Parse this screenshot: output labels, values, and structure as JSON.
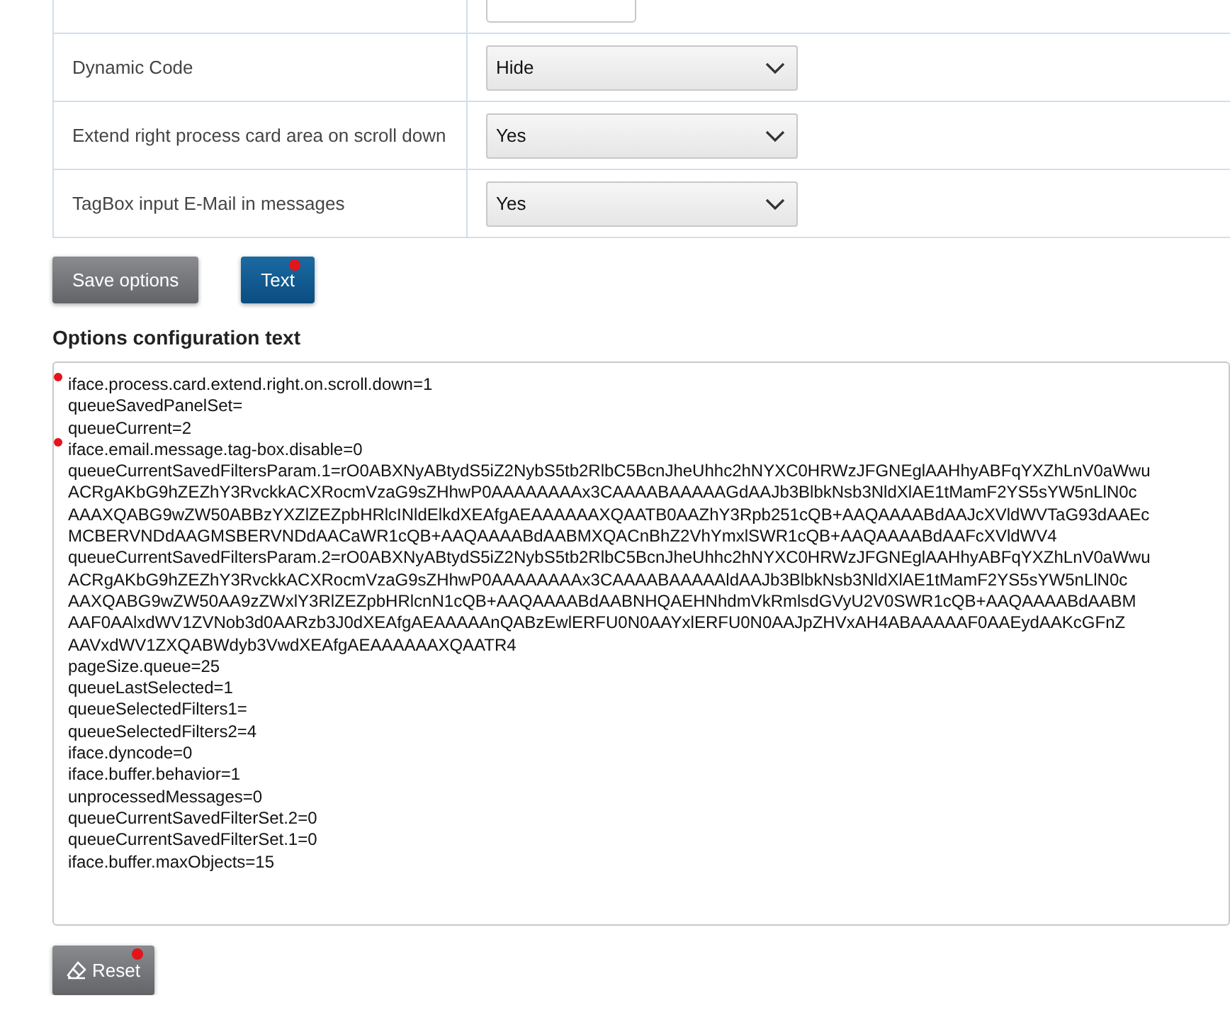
{
  "options_table": [
    {
      "label": "Dynamic Code",
      "kind": "select",
      "value": "Hide"
    },
    {
      "label": "Extend right process card area on scroll down",
      "kind": "select",
      "value": "Yes"
    },
    {
      "label": "TagBox input E-Mail in messages",
      "kind": "select",
      "value": "Yes"
    }
  ],
  "buttons": [
    {
      "label": "Save options",
      "kind": "grey",
      "marked": false
    },
    {
      "label": "Text",
      "kind": "blue",
      "marked": true
    }
  ],
  "config_heading": "Options configuration text",
  "config_lines": [
    {
      "text": "iface.process.card.extend.right.on.scroll.down=1",
      "marked": true
    },
    {
      "text": "queueSavedPanelSet=",
      "marked": false
    },
    {
      "text": "queueCurrent=2",
      "marked": false
    },
    {
      "text": "iface.email.message.tag-box.disable=0",
      "marked": true
    },
    {
      "text": "queueCurrentSavedFiltersParam.1=rO0ABXNyABtydS5iZ2NybS5tb2RlbC5BcnJheUhhc2hNYXC0HRWzJFGNEglAAHhyABFqYXZhLnV0aWwu",
      "marked": false
    },
    {
      "text": "ACRgAKbG9hZEZhY3RvckkACXRocmVzaG9sZHhwP0AAAAAAAAx3CAAAABAAAAAGdAAJb3BlbkNsb3NldXlAE1tMamF2YS5sYW5nLlN0c",
      "marked": false
    },
    {
      "text": "AAAXQABG9wZW50ABBzYXZlZEZpbHRlcINldElkdXEAfgAEAAAAAAXQAATB0AAZhY3Rpb251cQB+AAQAAAABdAAJcXVldWVTaG93dAAEc",
      "marked": false
    },
    {
      "text": "MCBERVNDdAAGMSBERVNDdAACaWR1cQB+AAQAAAABdAABMXQACnBhZ2VhYmxlSWR1cQB+AAQAAAABdAAFcXVldWV4",
      "marked": false
    },
    {
      "text": "queueCurrentSavedFiltersParam.2=rO0ABXNyABtydS5iZ2NybS5tb2RlbC5BcnJheUhhc2hNYXC0HRWzJFGNEglAAHhyABFqYXZhLnV0aWwu",
      "marked": false
    },
    {
      "text": "ACRgAKbG9hZEZhY3RvckkACXRocmVzaG9sZHhwP0AAAAAAAAx3CAAAABAAAAAldAAJb3BlbkNsb3NldXlAE1tMamF2YS5sYW5nLlN0c",
      "marked": false
    },
    {
      "text": "AAXQABG9wZW50AA9zZWxlY3RlZEZpbHRlcnN1cQB+AAQAAAABdAABNHQAEHNhdmVkRmlsdGVyU2V0SWR1cQB+AAQAAAABdAABM",
      "marked": false
    },
    {
      "text": "AAF0AAlxdWV1ZVNob3d0AARzb3J0dXEAfgAEAAAAAnQABzEwlERFU0N0AAYxlERFU0N0AAJpZHVxAH4ABAAAAAF0AAEydAAKcGFnZ",
      "marked": false
    },
    {
      "text": "AAVxdWV1ZXQABWdyb3VwdXEAfgAEAAAAAAXQAATR4",
      "marked": false
    },
    {
      "text": "pageSize.queue=25",
      "marked": false
    },
    {
      "text": "queueLastSelected=1",
      "marked": false
    },
    {
      "text": "queueSelectedFilters1=",
      "marked": false
    },
    {
      "text": "queueSelectedFilters2=4",
      "marked": false
    },
    {
      "text": "iface.dyncode=0",
      "marked": false
    },
    {
      "text": "iface.buffer.behavior=1",
      "marked": false
    },
    {
      "text": "unprocessedMessages=0",
      "marked": false
    },
    {
      "text": "queueCurrentSavedFilterSet.2=0",
      "marked": false
    },
    {
      "text": "queueCurrentSavedFilterSet.1=0",
      "marked": false
    },
    {
      "text": "iface.buffer.maxObjects=15",
      "marked": false
    }
  ],
  "reset_button": {
    "label": "Reset",
    "marked": true
  }
}
